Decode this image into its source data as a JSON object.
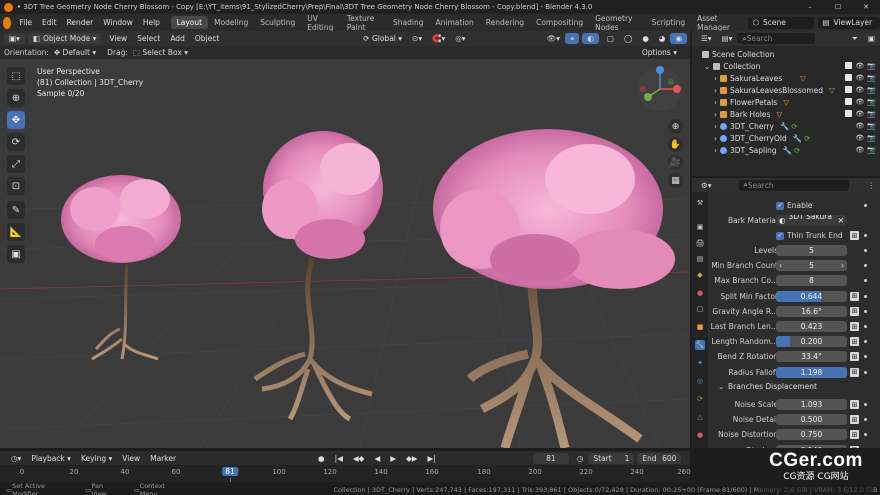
{
  "window": {
    "title": "• 3DT Tree Geometry Node Cherry Blossom - Copy [E:\\YT_items\\91_StylizedCherry\\Prep\\Final\\3DT Tree Geometry Node Cherry Blossom - Copy.blend] - Blender 4.3.0"
  },
  "menu": {
    "items": [
      "File",
      "Edit",
      "Render",
      "Window",
      "Help"
    ]
  },
  "workspaces": [
    "Layout",
    "Modeling",
    "Sculpting",
    "UV Editing",
    "Texture Paint",
    "Shading",
    "Animation",
    "Rendering",
    "Compositing",
    "Geometry Nodes",
    "Scripting",
    "Asset Manager"
  ],
  "active_workspace": "Layout",
  "scene": {
    "label": "Scene",
    "viewlayer": "ViewLayer"
  },
  "viewport_header": {
    "mode": "Object Mode",
    "menus": [
      "View",
      "Select",
      "Add",
      "Object"
    ],
    "orientation": "Global"
  },
  "options_bar": {
    "orientation_label": "Orientation:",
    "orientation_value": "Default",
    "drag_label": "Drag:",
    "drag_value": "Select Box",
    "options": "Options"
  },
  "viewport": {
    "line1": "User Perspective",
    "line2": "(81) Collection | 3DT_Cherry",
    "line3": "Sample 0/20"
  },
  "timeline": {
    "menus": [
      "Playback",
      "Keying",
      "View",
      "Marker"
    ],
    "current": "81",
    "start_label": "Start",
    "start": "1",
    "end_label": "End",
    "end": "600",
    "ticks": [
      "0",
      "20",
      "40",
      "60",
      "81",
      "100",
      "120",
      "140",
      "160",
      "180",
      "200",
      "220",
      "240",
      "260"
    ],
    "current_fraction": 0.31
  },
  "status": {
    "left": [
      "Set Active Modifier",
      "Pan View",
      "Context Menu"
    ],
    "right": "Collection | 3DT_Cherry | Verts:247,743 | Faces:197,311 | Tris:393,861 | Objects:0/72,428 | Duration: 00:25+00 (Frame 81/600) | Memory: 2.6 GiB | VRAM: 3.6/12.0 GiB | 4.3.0"
  },
  "outliner": {
    "search_placeholder": "Search",
    "rows": [
      {
        "label": "Scene Collection",
        "indent": 0,
        "icon": "collection-icon",
        "color": "#bdbdbd"
      },
      {
        "label": "Collection",
        "indent": 1,
        "icon": "collection-icon",
        "color": "#bdbdbd"
      },
      {
        "label": "SakuraLeaves",
        "indent": 2,
        "icon": "mesh-icon",
        "color": "#e09a3a"
      },
      {
        "label": "SakuraLeavesBlossomed",
        "indent": 2,
        "icon": "mesh-icon",
        "color": "#e09a3a"
      },
      {
        "label": "FlowerPetals",
        "indent": 2,
        "icon": "mesh-icon",
        "color": "#e09a3a"
      },
      {
        "label": "Bark Holes",
        "indent": 2,
        "icon": "mesh-icon",
        "color": "#e09a3a"
      },
      {
        "label": "3DT_Cherry",
        "indent": 2,
        "icon": "geometry-icon",
        "color": "#7aa2ff"
      },
      {
        "label": "3DT_CherryOld",
        "indent": 2,
        "icon": "geometry-icon",
        "color": "#7aa2ff"
      },
      {
        "label": "3DT_Sapling",
        "indent": 2,
        "icon": "geometry-icon",
        "color": "#7aa2ff"
      }
    ]
  },
  "properties": {
    "search_placeholder": "Search",
    "enable": "Enable",
    "bark_material_label": "Bark Material",
    "bark_material_value": "3DT Sakura ...",
    "thin_trunk": "Thin Trunk End",
    "fields": [
      {
        "label": "Levels",
        "value": "5",
        "fill": 0
      },
      {
        "label": "Min Branch Count",
        "value": "5",
        "fill": 0
      },
      {
        "label": "Max Branch Co...",
        "value": "8",
        "fill": 0
      },
      {
        "label": "Split Min Factor",
        "value": "0.644",
        "fill": 0.64
      },
      {
        "label": "Gravity Angle R...",
        "value": "16.6°",
        "fill": 0
      },
      {
        "label": "Last Branch Len...",
        "value": "0.423",
        "fill": 0
      },
      {
        "label": "Length Random...",
        "value": "0.200",
        "fill": 0.2
      },
      {
        "label": "Bend Z Rotation",
        "value": "33.4°",
        "fill": 0
      },
      {
        "label": "Radius Falloff",
        "value": "1.198",
        "fill": 1.0
      }
    ],
    "section": "Branches Displacement",
    "fields2": [
      {
        "label": "Noise Scale",
        "value": "1.093"
      },
      {
        "label": "Noise Detail",
        "value": "0.500"
      },
      {
        "label": "Noise Distortion",
        "value": "0.750"
      },
      {
        "label": "Displace",
        "value": "0.140"
      }
    ]
  },
  "watermark": {
    "big": "CGer.com",
    "small": "CG资源 CG网站"
  }
}
